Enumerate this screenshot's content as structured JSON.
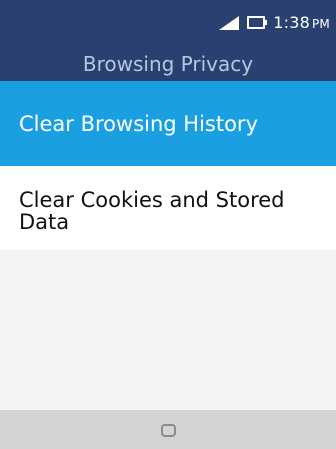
{
  "status_bar": {
    "time": "1:38",
    "ampm": "PM",
    "signal_icon": "signal-icon",
    "battery_icon": "battery-icon"
  },
  "header": {
    "title": "Browsing Privacy"
  },
  "menu": {
    "items": [
      {
        "label": "Clear Browsing History",
        "selected": true
      },
      {
        "label": "Clear Cookies and Stored Data",
        "selected": false
      }
    ]
  },
  "softkeys": {
    "center_icon": "circle-icon"
  },
  "colors": {
    "header_bg": "#2a4070",
    "selected_bg": "#1aa0e0",
    "softkey_bg": "#d4d4d4"
  }
}
